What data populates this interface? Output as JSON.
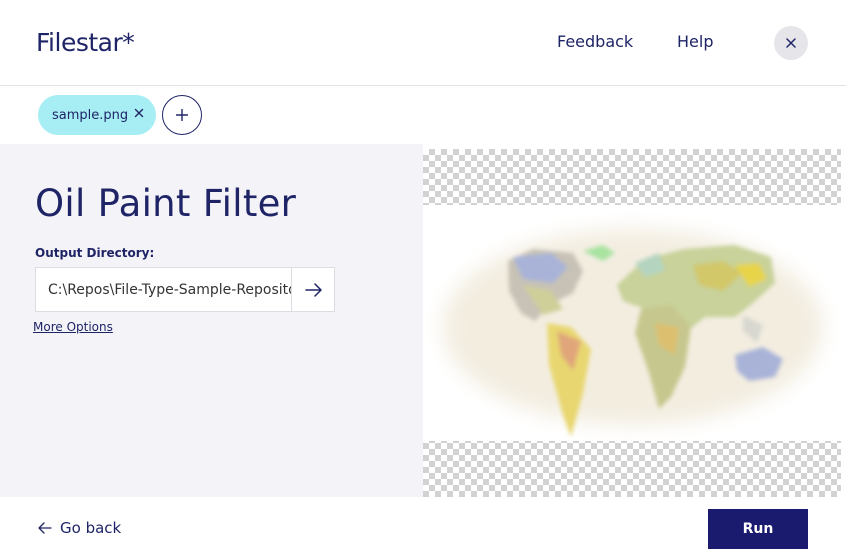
{
  "app": {
    "logo": "Filestar*"
  },
  "header": {
    "feedback_label": "Feedback",
    "help_label": "Help",
    "close_icon": "close-icon"
  },
  "tabs": {
    "file_name": "sample.png",
    "remove_icon": "close-icon",
    "add_icon": "plus-icon"
  },
  "main": {
    "title": "Oil Paint Filter",
    "output_label": "Output Directory:",
    "output_value": "C:\\Repos\\File-Type-Sample-Repository",
    "go_icon": "arrow-right-icon",
    "more_options_label": "More Options"
  },
  "footer": {
    "go_back_label": "Go back",
    "go_back_icon": "arrow-left-icon",
    "run_label": "Run"
  },
  "colors": {
    "brand": "#1f2466",
    "tab_accent": "#a6eef3",
    "run_button": "#1a1a6e",
    "panel_bg": "#f4f4f8"
  }
}
